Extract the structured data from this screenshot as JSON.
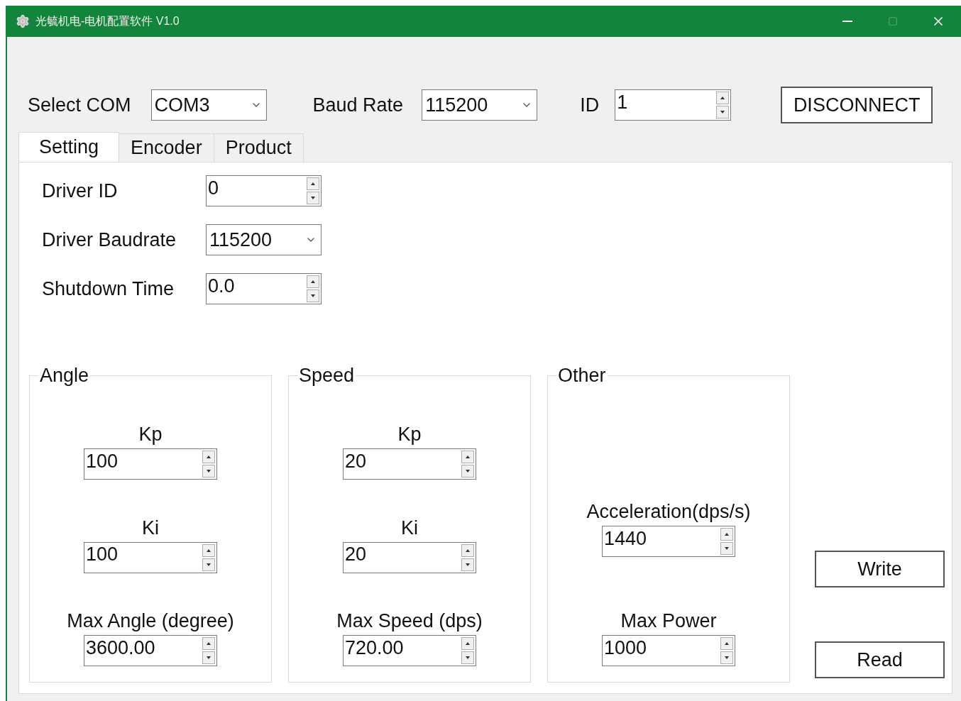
{
  "window": {
    "title": "光毓机电-电机配置软件 V1.0",
    "maximize_disabled": true
  },
  "connection": {
    "com_label": "Select COM",
    "com_value": "COM3",
    "baud_label": "Baud Rate",
    "baud_value": "115200",
    "id_label": "ID",
    "id_value": "1",
    "button": "DISCONNECT"
  },
  "tabs": [
    {
      "label": "Setting",
      "selected": true
    },
    {
      "label": "Encoder",
      "selected": false
    },
    {
      "label": "Product",
      "selected": false
    }
  ],
  "driver_fields": [
    {
      "kind": "spinner",
      "label": "Driver ID",
      "value": "0"
    },
    {
      "kind": "dropdown",
      "label": "Driver Baudrate",
      "value": "115200"
    },
    {
      "kind": "spinner",
      "label": "Shutdown Time",
      "value": "0.0"
    }
  ],
  "groups": [
    {
      "title": "Angle",
      "fields": [
        {
          "label": "Kp",
          "value": "100"
        },
        {
          "label": "Ki",
          "value": "100"
        },
        {
          "label": "Max Angle (degree)",
          "value": "3600.00"
        }
      ]
    },
    {
      "title": "Speed",
      "fields": [
        {
          "label": "Kp",
          "value": "20"
        },
        {
          "label": "Ki",
          "value": "20"
        },
        {
          "label": "Max Speed (dps)",
          "value": "720.00"
        }
      ]
    },
    {
      "title": "Other",
      "fields": [
        {
          "label": "Acceleration(dps/s)",
          "value": "1440"
        },
        {
          "label": "Max Power",
          "value": "1000"
        }
      ]
    }
  ],
  "buttons": [
    "Write",
    "Read"
  ]
}
